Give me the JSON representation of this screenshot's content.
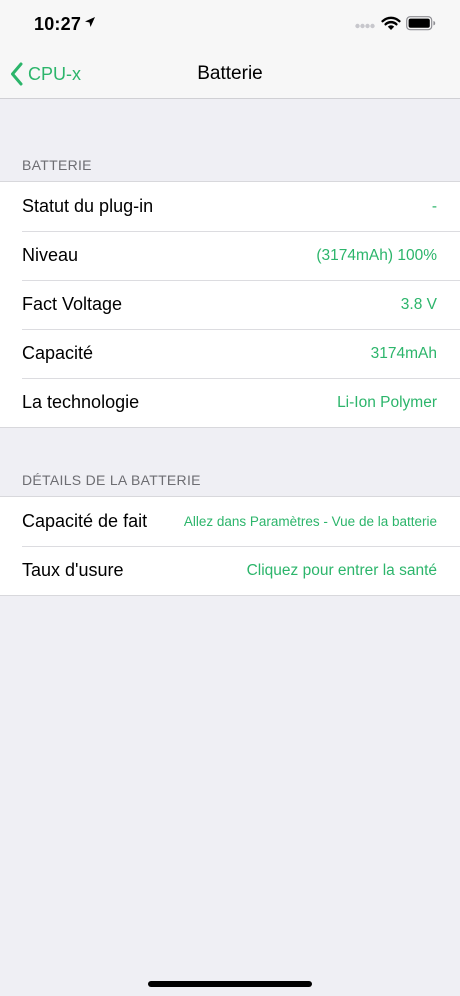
{
  "status_bar": {
    "time": "10:27"
  },
  "nav": {
    "back_label": "CPU-x",
    "title": "Batterie"
  },
  "sections": [
    {
      "header": "BATTERIE",
      "rows": [
        {
          "label": "Statut du plug-in",
          "value": "-"
        },
        {
          "label": "Niveau",
          "value": "(3174mAh) 100%"
        },
        {
          "label": "Fact Voltage",
          "value": "3.8 V"
        },
        {
          "label": "Capacité",
          "value": "3174mAh"
        },
        {
          "label": "La technologie",
          "value": "Li-Ion Polymer"
        }
      ]
    },
    {
      "header": "DÉTAILS DE LA BATTERIE",
      "rows": [
        {
          "label": "Capacité de fait",
          "value": "Allez dans Paramètres - Vue de la batterie"
        },
        {
          "label": "Taux d'usure",
          "value": "Cliquez pour entrer la santé"
        }
      ]
    }
  ],
  "colors": {
    "accent": "#2cb56b",
    "background": "#efeff4"
  }
}
